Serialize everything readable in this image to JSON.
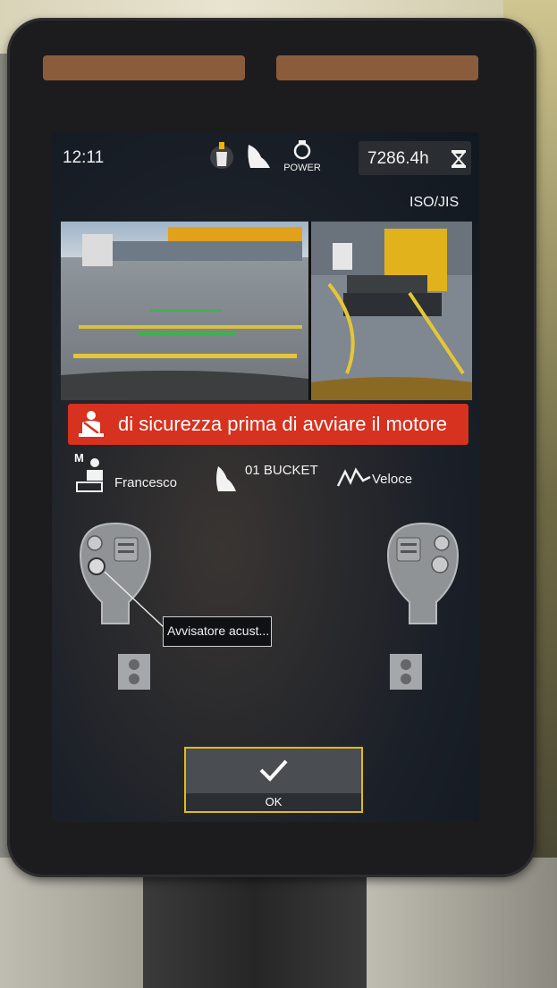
{
  "status_bar": {
    "time": "12:11",
    "power_label": "POWER",
    "hours": "7286.4h",
    "pattern": "ISO/JIS",
    "icons": [
      "attachment-icon",
      "bucket-icon",
      "power-icon",
      "hourglass-icon"
    ]
  },
  "warning": {
    "text": "di sicurezza prima di avviare il motore",
    "icon": "seatbelt-icon",
    "color": "#d7311f"
  },
  "info_row": {
    "operator_mode": "M",
    "operator_name": "Francesco",
    "attachment": "01 BUCKET",
    "speed_mode": "Veloce"
  },
  "joysticks": {
    "callout": "Avvisatore acust..."
  },
  "ok_button": {
    "label": "OK",
    "accent": "#e2bc10"
  }
}
